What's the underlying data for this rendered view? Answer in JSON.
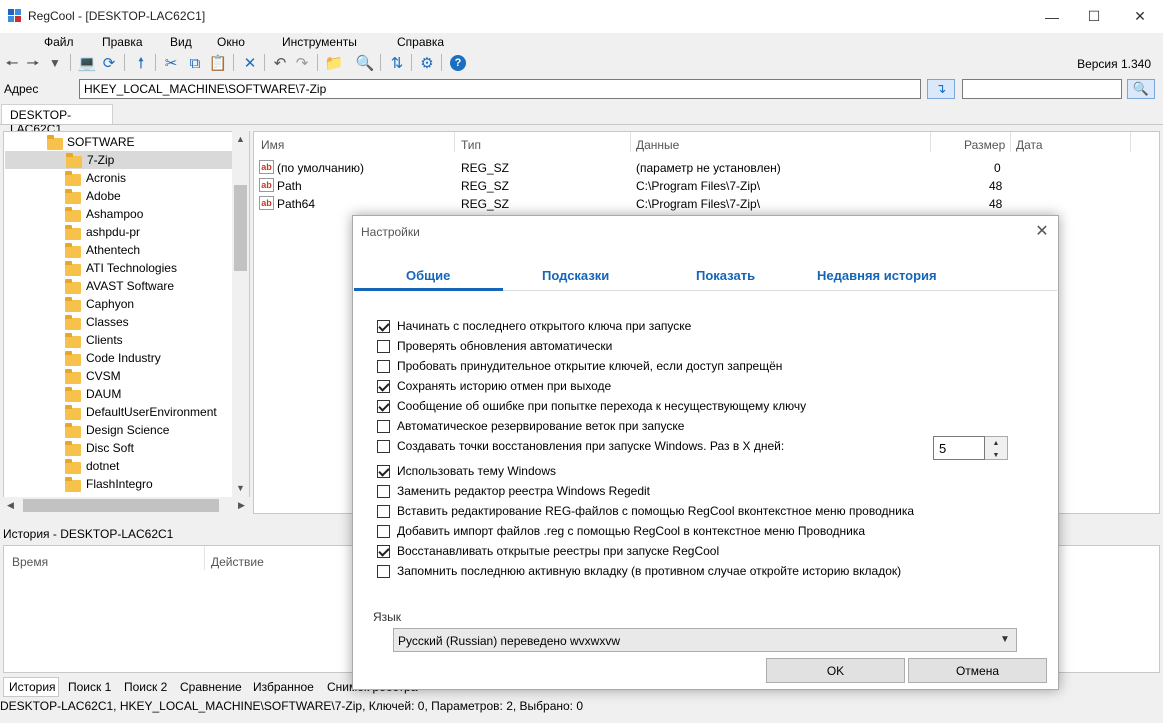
{
  "window": {
    "title": "RegCool - [DESKTOP-LAC62C1]",
    "version": "Версия 1.340"
  },
  "menu": [
    "Файл",
    "Правка",
    "Вид",
    "Окно",
    "Инструменты",
    "Справка"
  ],
  "address": {
    "label": "Адрес",
    "value": "HKEY_LOCAL_MACHINE\\SOFTWARE\\7-Zip",
    "search_value": ""
  },
  "machine_tab": "DESKTOP-LAC62C1",
  "tree": {
    "root": "SOFTWARE",
    "selected": "7-Zip",
    "items": [
      "Acronis",
      "Adobe",
      "Ashampoo",
      "ashpdu-pr",
      "Athentech",
      "ATI Technologies",
      "AVAST Software",
      "Caphyon",
      "Classes",
      "Clients",
      "Code Industry",
      "CVSM",
      "DAUM",
      "DefaultUserEnvironment",
      "Design Science",
      "Disc Soft",
      "dotnet",
      "FlashIntegro"
    ]
  },
  "list": {
    "columns": [
      "Имя",
      "Тип",
      "Данные",
      "Размер",
      "Дата"
    ],
    "rows": [
      {
        "name": "(по умолчанию)",
        "type": "REG_SZ",
        "data": "(параметр не установлен)",
        "size": "0"
      },
      {
        "name": "Path",
        "type": "REG_SZ",
        "data": "C:\\Program Files\\7-Zip\\",
        "size": "48"
      },
      {
        "name": "Path64",
        "type": "REG_SZ",
        "data": "C:\\Program Files\\7-Zip\\",
        "size": "48"
      }
    ]
  },
  "history": {
    "title": "История - DESKTOP-LAC62C1",
    "columns": [
      "Время",
      "Действие"
    ]
  },
  "bottom_tabs": [
    "История",
    "Поиск 1",
    "Поиск 2",
    "Сравнение",
    "Избранное",
    "Снимок реестра"
  ],
  "status": "DESKTOP-LAC62C1, HKEY_LOCAL_MACHINE\\SOFTWARE\\7-Zip, Ключей: 0, Параметров: 2, Выбрано: 0",
  "dialog": {
    "title": "Настройки",
    "tabs": [
      "Общие",
      "Подсказки",
      "Показать",
      "Недавняя история"
    ],
    "active_tab": 0,
    "options": [
      {
        "label": "Начинать с последнего открытого ключа при запуске",
        "checked": true
      },
      {
        "label": "Проверять обновления автоматически",
        "checked": false
      },
      {
        "label": "Пробовать принудительное открытие ключей, если доступ запрещён",
        "checked": false
      },
      {
        "label": "Сохранять историю отмен при выходе",
        "checked": true
      },
      {
        "label": "Сообщение об ошибке при попытке перехода к несуществующему ключу",
        "checked": true
      },
      {
        "label": "Автоматическое резервирование веток при запуске",
        "checked": false
      },
      {
        "label": "Создавать точки восстановления при запуске Windows. Раз в X дней:",
        "checked": false
      },
      {
        "label": "Использовать тему Windows",
        "checked": true
      },
      {
        "label": "Заменить редактор реестра Windows Regedit",
        "checked": false
      },
      {
        "label": "Вставить редактирование REG-файлов с помощью RegCool вконтекстное меню проводника",
        "checked": false
      },
      {
        "label": "Добавить импорт файлов .reg с помощью RegCool в контекстное меню Проводника",
        "checked": false
      },
      {
        "label": "Восстанавливать открытые реестры при запуске RegCool",
        "checked": true
      },
      {
        "label": "Запомнить последнюю активную вкладку (в противном случае откройте историю вкладок)",
        "checked": false
      }
    ],
    "restore_days": "5",
    "language_label": "Язык",
    "language_value": "Русский (Russian) переведено wvxwxvw",
    "ok_label": "OK",
    "cancel_label": "Отмена"
  },
  "colors": {
    "accent": "#1565b8",
    "folder": "#f7c24b",
    "selection": "#d9d9d9"
  }
}
